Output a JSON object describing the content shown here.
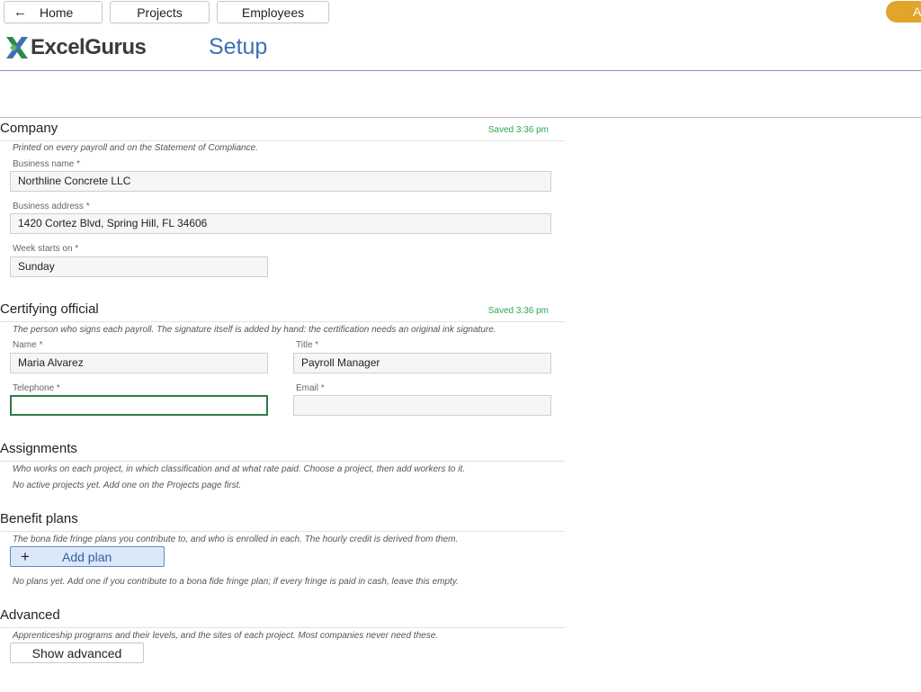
{
  "nav": {
    "home_label": "Home",
    "home_icon": "arrow-left-icon",
    "projects_label": "Projects",
    "employees_label": "Employees",
    "user_initial": "A",
    "user_color": "#e0a52a"
  },
  "header": {
    "logo_text": "ExcelGurus",
    "page_title": "Setup",
    "title_color": "#3f6fb4"
  },
  "company": {
    "title": "Company",
    "saved": "Saved 3:36 pm",
    "description": "Printed on every payroll and on the Statement of Compliance.",
    "business_name_label": "Business name *",
    "business_name_value": "Northline Concrete LLC",
    "business_address_label": "Business address *",
    "business_address_value": "1420 Cortez Blvd, Spring Hill, FL 34606",
    "week_starts_label": "Week starts on *",
    "week_starts_value": "Sunday"
  },
  "certifying": {
    "title": "Certifying official",
    "saved": "Saved 3:36 pm",
    "description": "The person who signs each payroll. The signature itself is added by hand: the certification needs an original ink signature.",
    "name_label": "Name *",
    "name_value": "Maria Alvarez",
    "title_label": "Title *",
    "title_value": "Payroll Manager",
    "telephone_label": "Telephone *",
    "telephone_value": "",
    "email_label": "Email *",
    "email_value": ""
  },
  "assignments": {
    "title": "Assignments",
    "description": "Who works on each project, in which classification and at what rate paid. Choose a project, then add workers to it.",
    "empty": "No active projects yet. Add one on the Projects page first."
  },
  "benefits": {
    "title": "Benefit plans",
    "description": "The bona fide fringe plans you contribute to, and who is enrolled in each. The hourly credit is derived from them.",
    "add_plan_label": "Add plan",
    "empty": "No plans yet. Add one if you contribute to a bona fide fringe plan; if every fringe is paid in cash, leave this empty."
  },
  "advanced": {
    "title": "Advanced",
    "description": "Apprenticeship programs and their levels, and the sites of each project. Most companies never need these.",
    "show_label": "Show advanced"
  }
}
